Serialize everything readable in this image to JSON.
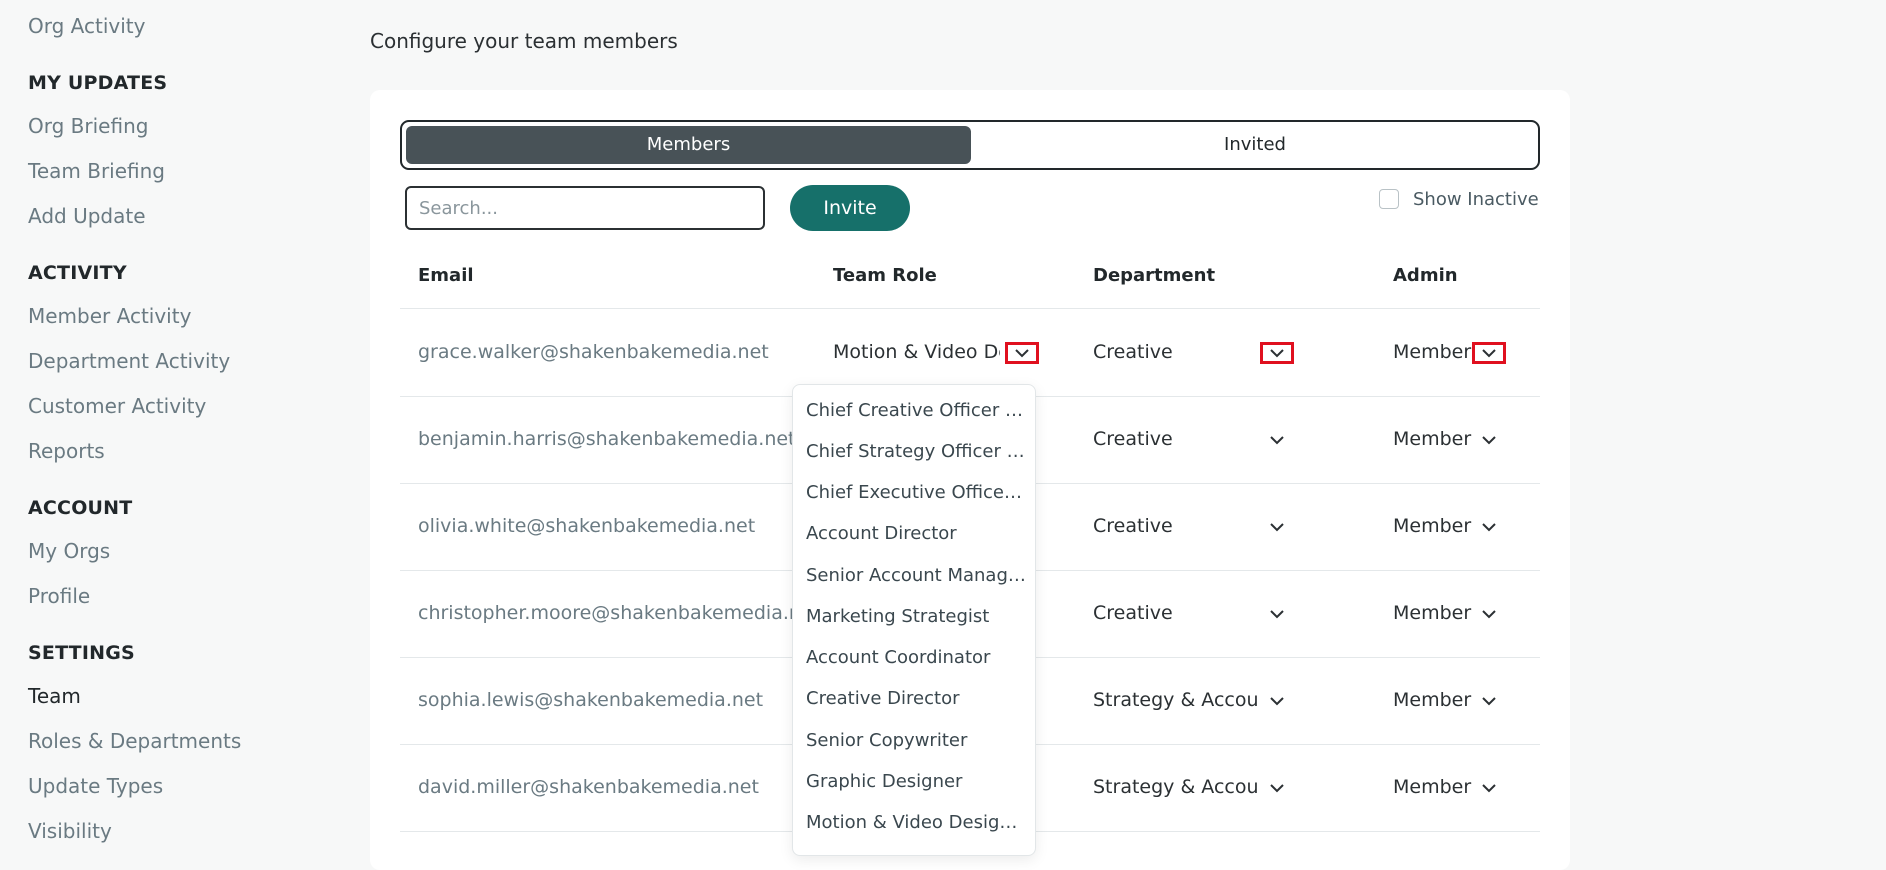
{
  "sidebar": {
    "items_top": [
      {
        "label": "Org Activity"
      }
    ],
    "sections": [
      {
        "heading": "MY UPDATES",
        "items": [
          {
            "label": "Org Briefing"
          },
          {
            "label": "Team Briefing"
          },
          {
            "label": "Add Update"
          }
        ]
      },
      {
        "heading": "ACTIVITY",
        "items": [
          {
            "label": "Member Activity"
          },
          {
            "label": "Department Activity"
          },
          {
            "label": "Customer Activity"
          },
          {
            "label": "Reports"
          }
        ]
      },
      {
        "heading": "ACCOUNT",
        "items": [
          {
            "label": "My Orgs"
          },
          {
            "label": "Profile"
          }
        ]
      },
      {
        "heading": "SETTINGS",
        "items": [
          {
            "label": "Team"
          },
          {
            "label": "Roles & Departments"
          },
          {
            "label": "Update Types"
          },
          {
            "label": "Visibility"
          }
        ]
      }
    ]
  },
  "main": {
    "subtitle": "Configure your team members",
    "tabs": [
      {
        "label": "Members"
      },
      {
        "label": "Invited"
      }
    ],
    "search": {
      "placeholder": "Search...",
      "value": ""
    },
    "invite_label": "Invite",
    "show_inactive_label": "Show Inactive",
    "columns": {
      "email": "Email",
      "role": "Team Role",
      "department": "Department",
      "admin": "Admin"
    },
    "rows": [
      {
        "email": "grace.walker@shakenbakemedia.net",
        "role": "Motion & Video Designer",
        "department": "Creative",
        "admin": "Member"
      },
      {
        "email": "benjamin.harris@shakenbakemedia.net",
        "role": "",
        "department": "Creative",
        "admin": "Member"
      },
      {
        "email": "olivia.white@shakenbakemedia.net",
        "role": "",
        "department": "Creative",
        "admin": "Member"
      },
      {
        "email": "christopher.moore@shakenbakemedia.net",
        "role": "",
        "department": "Creative",
        "admin": "Member"
      },
      {
        "email": "sophia.lewis@shakenbakemedia.net",
        "role": "",
        "department": "Strategy & Account",
        "admin": "Member"
      },
      {
        "email": "david.miller@shakenbakemedia.net",
        "role": "",
        "department": "Strategy & Account",
        "admin": "Member"
      }
    ],
    "role_dropdown": {
      "options": [
        "Chief Creative Officer (…",
        "Chief Strategy Officer (…",
        "Chief Executive Officer …",
        "Account Director",
        "Senior Account Manag…",
        "Marketing Strategist",
        "Account Coordinator",
        "Creative Director",
        "Senior Copywriter",
        "Graphic Designer",
        "Motion & Video Designer"
      ]
    }
  }
}
